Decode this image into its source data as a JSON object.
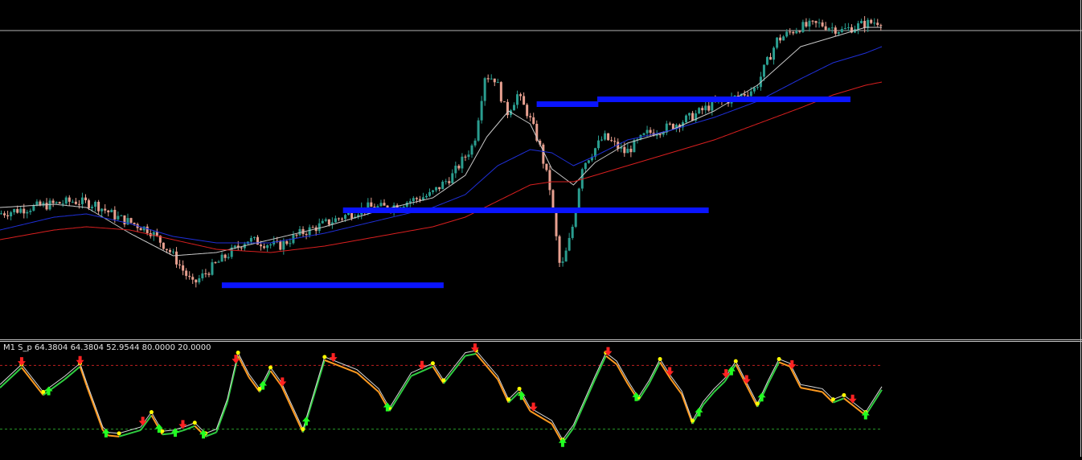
{
  "indicator_label": "M1 S_p 64.3804 64.3804 52.9544 80.0000 20.0000",
  "colors": {
    "background": "#000000",
    "bull_candle": "#2a9d8f",
    "bear_candle": "#e8a090",
    "ma_fast": "#c8c8c8",
    "ma_mid": "#1f2fd8",
    "ma_slow": "#d81f1f",
    "zone": "#0a14ff",
    "osc_main": "#d8d8d8",
    "osc_up": "#2ecc40",
    "osc_down": "#ff9a1f",
    "dot": "#ffff00",
    "buy_arrow": "#22ff22",
    "sell_arrow": "#ff2222",
    "level_high": "#c02020",
    "level_low": "#2a9a2a",
    "panel_border": "#c8c8c8"
  },
  "chart_data": [
    {
      "type": "candlestick",
      "title": "",
      "xlabel": "",
      "ylabel": "",
      "grid": false,
      "ylim": [
        0,
        100
      ],
      "xlim": [
        0,
        100
      ],
      "price_path": [
        [
          0,
          36
        ],
        [
          3,
          38
        ],
        [
          7,
          40
        ],
        [
          9,
          39
        ],
        [
          11,
          35
        ],
        [
          14,
          31
        ],
        [
          16,
          24
        ],
        [
          18,
          14
        ],
        [
          20,
          20
        ],
        [
          23,
          28
        ],
        [
          26,
          26
        ],
        [
          28,
          30
        ],
        [
          31,
          34
        ],
        [
          34,
          38
        ],
        [
          36,
          38
        ],
        [
          38,
          40
        ],
        [
          40,
          42
        ],
        [
          42,
          48
        ],
        [
          44,
          58
        ],
        [
          45,
          79
        ],
        [
          46,
          78
        ],
        [
          47,
          67
        ],
        [
          48,
          73
        ],
        [
          49,
          67
        ],
        [
          50,
          58
        ],
        [
          51,
          44
        ],
        [
          52,
          18
        ],
        [
          53,
          30
        ],
        [
          54,
          51
        ],
        [
          56,
          60
        ],
        [
          58,
          55
        ],
        [
          60,
          61
        ],
        [
          62,
          63
        ],
        [
          64,
          66
        ],
        [
          66,
          70
        ],
        [
          68,
          72
        ],
        [
          70,
          75
        ],
        [
          72,
          90
        ],
        [
          74,
          94
        ],
        [
          76,
          95
        ],
        [
          78,
          93
        ],
        [
          80,
          95
        ],
        [
          81.5,
          96
        ]
      ],
      "series": [
        {
          "name": "",
          "kind": "ma_fast",
          "points": [
            [
              0,
              38
            ],
            [
              5,
              39
            ],
            [
              8,
              38
            ],
            [
              12,
              30
            ],
            [
              16,
              23
            ],
            [
              20,
              24
            ],
            [
              25,
              28
            ],
            [
              30,
              32
            ],
            [
              35,
              37
            ],
            [
              40,
              41
            ],
            [
              43,
              48
            ],
            [
              45,
              60
            ],
            [
              47,
              68
            ],
            [
              49,
              64
            ],
            [
              51,
              50
            ],
            [
              53,
              45
            ],
            [
              55,
              52
            ],
            [
              58,
              58
            ],
            [
              62,
              62
            ],
            [
              66,
              68
            ],
            [
              70,
              76
            ],
            [
              74,
              88
            ],
            [
              77,
              91
            ],
            [
              80,
              94
            ],
            [
              81.5,
              94
            ]
          ]
        },
        {
          "name": "",
          "kind": "ma_mid",
          "points": [
            [
              0,
              31
            ],
            [
              5,
              35
            ],
            [
              8,
              36
            ],
            [
              12,
              33
            ],
            [
              16,
              29
            ],
            [
              20,
              27
            ],
            [
              25,
              27
            ],
            [
              30,
              30
            ],
            [
              35,
              34
            ],
            [
              40,
              38
            ],
            [
              43,
              42
            ],
            [
              46,
              51
            ],
            [
              49,
              56
            ],
            [
              51,
              55
            ],
            [
              53,
              51
            ],
            [
              55,
              54
            ],
            [
              58,
              59
            ],
            [
              62,
              62
            ],
            [
              66,
              66
            ],
            [
              70,
              71
            ],
            [
              74,
              78
            ],
            [
              77,
              83
            ],
            [
              80,
              86
            ],
            [
              81.5,
              88
            ]
          ]
        },
        {
          "name": "",
          "kind": "ma_slow",
          "points": [
            [
              0,
              28
            ],
            [
              5,
              31
            ],
            [
              8,
              32
            ],
            [
              12,
              31
            ],
            [
              16,
              28
            ],
            [
              20,
              25
            ],
            [
              25,
              24
            ],
            [
              30,
              26
            ],
            [
              35,
              29
            ],
            [
              40,
              32
            ],
            [
              43,
              35
            ],
            [
              46,
              40
            ],
            [
              49,
              45
            ],
            [
              51,
              46
            ],
            [
              53,
              46
            ],
            [
              55,
              48
            ],
            [
              58,
              51
            ],
            [
              62,
              55
            ],
            [
              66,
              59
            ],
            [
              70,
              64
            ],
            [
              74,
              69
            ],
            [
              77,
              73
            ],
            [
              80,
              76
            ],
            [
              81.5,
              77
            ]
          ]
        }
      ],
      "zones": [
        [
          20.5,
          41,
          13.7
        ],
        [
          31.7,
          65.5,
          37
        ],
        [
          49.6,
          55.3,
          70
        ],
        [
          55.2,
          78.6,
          71.5
        ]
      ],
      "current_price_level": 93
    },
    {
      "type": "line",
      "title": "",
      "ylim": [
        0,
        100
      ],
      "xlim": [
        0,
        100
      ],
      "levels": [
        80,
        20
      ],
      "series": [
        {
          "name": "S_p",
          "values": [
            [
              0,
              62
            ],
            [
              2,
              81
            ],
            [
              4,
              55
            ],
            [
              6,
              70
            ],
            [
              7.4,
              82
            ],
            [
              8,
              64
            ],
            [
              9.5,
              22
            ],
            [
              10,
              17
            ],
            [
              11,
              16
            ],
            [
              13,
              22
            ],
            [
              14,
              36
            ],
            [
              15,
              18
            ],
            [
              16,
              19
            ],
            [
              17,
              22
            ],
            [
              18,
              26
            ],
            [
              19,
              16
            ],
            [
              20,
              20
            ],
            [
              21,
              48
            ],
            [
              22,
              92
            ],
            [
              23,
              72
            ],
            [
              24,
              58
            ],
            [
              25,
              78
            ],
            [
              26,
              64
            ],
            [
              28,
              20
            ],
            [
              30,
              88
            ],
            [
              32,
              80
            ],
            [
              33,
              76
            ],
            [
              35,
              58
            ],
            [
              36,
              40
            ],
            [
              38,
              73
            ],
            [
              40,
              82
            ],
            [
              41,
              66
            ],
            [
              43,
              92
            ],
            [
              44,
              94
            ],
            [
              46,
              70
            ],
            [
              47,
              48
            ],
            [
              48,
              58
            ],
            [
              49,
              40
            ],
            [
              51,
              28
            ],
            [
              52,
              10
            ],
            [
              53,
              24
            ],
            [
              55,
              70
            ],
            [
              56,
              92
            ],
            [
              57,
              84
            ],
            [
              58,
              66
            ],
            [
              59,
              50
            ],
            [
              60,
              66
            ],
            [
              61,
              86
            ],
            [
              62,
              70
            ],
            [
              63,
              56
            ],
            [
              64,
              28
            ],
            [
              65,
              46
            ],
            [
              66,
              58
            ],
            [
              67,
              68
            ],
            [
              68,
              84
            ],
            [
              69,
              64
            ],
            [
              70,
              44
            ],
            [
              71,
              66
            ],
            [
              72,
              86
            ],
            [
              73,
              82
            ],
            [
              74,
              62
            ],
            [
              75,
              60
            ],
            [
              76,
              58
            ],
            [
              77,
              48
            ],
            [
              78,
              52
            ],
            [
              79,
              44
            ],
            [
              80,
              36
            ],
            [
              81.5,
              60
            ]
          ]
        }
      ],
      "buy_signals": [
        4.5,
        9.8,
        14.7,
        16.2,
        18.8,
        24.3,
        28.3,
        35.8,
        48.2,
        52,
        58.8,
        64.6,
        67.6,
        70.4,
        80
      ],
      "sell_signals": [
        2,
        7.4,
        13.2,
        16.9,
        21.8,
        26.1,
        30.8,
        39,
        43.9,
        49.3,
        56.2,
        61.9,
        67.1,
        69,
        73.2,
        78.8
      ]
    }
  ]
}
